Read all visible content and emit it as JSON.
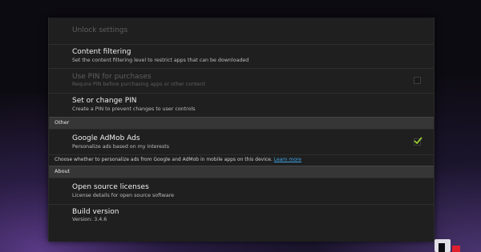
{
  "settings": {
    "unlock": {
      "title": "Unlock settings"
    },
    "content_filtering": {
      "title": "Content filtering",
      "subtitle": "Set the content filtering level to restrict apps that can be downloaded"
    },
    "use_pin": {
      "title": "Use PIN for purchases",
      "subtitle": "Require PIN before purchasing apps or other content",
      "checked": false
    },
    "set_pin": {
      "title": "Set or change PIN",
      "subtitle": "Create a PIN to prevent changes to user controls"
    },
    "other_header": "Other",
    "admob": {
      "title": "Google AdMob Ads",
      "subtitle": "Personalize ads based on my interests",
      "checked": true
    },
    "note": {
      "text": "Choose whether to personalize ads from Google and AdMob in mobile apps on this device.",
      "link": "Learn more"
    },
    "about_header": "About",
    "open_source": {
      "title": "Open source licenses",
      "subtitle": "License details for open source software"
    },
    "build_version": {
      "title": "Build version",
      "subtitle": "Version: 3.4.6"
    }
  },
  "colors": {
    "panel": "#1f1f1f",
    "header": "#363636",
    "link": "#3fa6e6",
    "check": "#9acd32"
  },
  "watermark": {
    "icon": "droid-life-logo"
  }
}
